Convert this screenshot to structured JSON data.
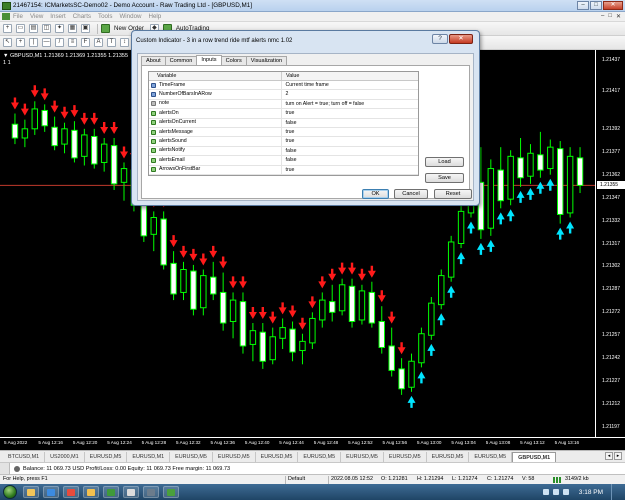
{
  "window": {
    "title": "21467154: ICMarketsSC-Demo02 - Demo Account - Raw Trading Ltd - [GBPUSD,M1]",
    "controls": [
      "–",
      "□",
      "✕"
    ]
  },
  "menu": {
    "items": [
      "File",
      "View",
      "Insert",
      "Charts",
      "Tools",
      "Window",
      "Help"
    ],
    "mdi_controls": [
      "–",
      "□",
      "✕"
    ]
  },
  "toolbar": {
    "new_order": "New Order",
    "autotrading": "AutoTrading"
  },
  "chart": {
    "info_line1": "▼ GBPUSD,M1  1.21369 1.21369 1.21355 1.21355",
    "info_line2": "1   1",
    "current_price": "1.21355",
    "price_ticks": [
      "1.21437",
      "1.21417",
      "1.21392",
      "1.21377",
      "1.21362",
      "1.21347",
      "1.21332",
      "1.21317",
      "1.21302",
      "1.21287",
      "1.21272",
      "1.21257",
      "1.21242",
      "1.21227",
      "1.21212",
      "1.21197"
    ],
    "time_labels": [
      "5 Aug 2022",
      "5 Aug 12:16",
      "5 Aug 12:20",
      "5 Aug 12:24",
      "5 Aug 12:28",
      "5 Aug 12:32",
      "5 Aug 12:36",
      "5 Aug 12:40",
      "5 Aug 12:44",
      "5 Aug 12:48",
      "5 Aug 12:52",
      "5 Aug 12:56",
      "5 Aug 13:00",
      "5 Aug 13:04",
      "5 Aug 13:08",
      "5 Aug 13:12",
      "5 Aug 13:16"
    ],
    "colors": {
      "bull": "#00ff00",
      "bear": "#00ff00",
      "up_arrow": "#00e5ff",
      "down_arrow": "#ff1a1a",
      "price_line": "#c0392b"
    }
  },
  "chart_data": {
    "type": "candlestick",
    "title": "GBPUSD,M1",
    "candles": [
      {
        "o": 1.21395,
        "h": 1.21402,
        "l": 1.21382,
        "c": 1.21386
      },
      {
        "o": 1.21386,
        "h": 1.21398,
        "l": 1.2138,
        "c": 1.21392
      },
      {
        "o": 1.21392,
        "h": 1.2141,
        "l": 1.21388,
        "c": 1.21405
      },
      {
        "o": 1.21404,
        "h": 1.21408,
        "l": 1.2139,
        "c": 1.21394
      },
      {
        "o": 1.21393,
        "h": 1.214,
        "l": 1.21378,
        "c": 1.21381
      },
      {
        "o": 1.21382,
        "h": 1.21396,
        "l": 1.21376,
        "c": 1.21392
      },
      {
        "o": 1.21391,
        "h": 1.21397,
        "l": 1.2137,
        "c": 1.21373
      },
      {
        "o": 1.21374,
        "h": 1.21392,
        "l": 1.21368,
        "c": 1.21388
      },
      {
        "o": 1.21387,
        "h": 1.21392,
        "l": 1.21366,
        "c": 1.21369
      },
      {
        "o": 1.2137,
        "h": 1.21386,
        "l": 1.21364,
        "c": 1.21382
      },
      {
        "o": 1.21381,
        "h": 1.21386,
        "l": 1.21352,
        "c": 1.21356
      },
      {
        "o": 1.21357,
        "h": 1.2137,
        "l": 1.21345,
        "c": 1.21366
      },
      {
        "o": 1.21365,
        "h": 1.21369,
        "l": 1.21338,
        "c": 1.21342
      },
      {
        "o": 1.21343,
        "h": 1.21348,
        "l": 1.21318,
        "c": 1.21322
      },
      {
        "o": 1.21323,
        "h": 1.21338,
        "l": 1.21312,
        "c": 1.21334
      },
      {
        "o": 1.21333,
        "h": 1.21338,
        "l": 1.213,
        "c": 1.21303
      },
      {
        "o": 1.21304,
        "h": 1.21312,
        "l": 1.2128,
        "c": 1.21284
      },
      {
        "o": 1.21285,
        "h": 1.21305,
        "l": 1.2128,
        "c": 1.213
      },
      {
        "o": 1.21299,
        "h": 1.21303,
        "l": 1.2127,
        "c": 1.21274
      },
      {
        "o": 1.21275,
        "h": 1.213,
        "l": 1.2127,
        "c": 1.21296
      },
      {
        "o": 1.21295,
        "h": 1.21305,
        "l": 1.2128,
        "c": 1.21284
      },
      {
        "o": 1.21285,
        "h": 1.21298,
        "l": 1.2126,
        "c": 1.21265
      },
      {
        "o": 1.21266,
        "h": 1.21285,
        "l": 1.21255,
        "c": 1.2128
      },
      {
        "o": 1.21279,
        "h": 1.21285,
        "l": 1.21245,
        "c": 1.2125
      },
      {
        "o": 1.21251,
        "h": 1.21265,
        "l": 1.2124,
        "c": 1.2126
      },
      {
        "o": 1.21259,
        "h": 1.21265,
        "l": 1.21235,
        "c": 1.2124
      },
      {
        "o": 1.21241,
        "h": 1.21262,
        "l": 1.21238,
        "c": 1.21256
      },
      {
        "o": 1.21255,
        "h": 1.21268,
        "l": 1.21248,
        "c": 1.21262
      },
      {
        "o": 1.21261,
        "h": 1.21266,
        "l": 1.2124,
        "c": 1.21246
      },
      {
        "o": 1.21247,
        "h": 1.21258,
        "l": 1.21238,
        "c": 1.21253
      },
      {
        "o": 1.21252,
        "h": 1.21272,
        "l": 1.21248,
        "c": 1.21268
      },
      {
        "o": 1.21267,
        "h": 1.21285,
        "l": 1.21262,
        "c": 1.2128
      },
      {
        "o": 1.21279,
        "h": 1.2129,
        "l": 1.21266,
        "c": 1.21272
      },
      {
        "o": 1.21273,
        "h": 1.21294,
        "l": 1.2127,
        "c": 1.2129
      },
      {
        "o": 1.21289,
        "h": 1.21294,
        "l": 1.21262,
        "c": 1.21266
      },
      {
        "o": 1.21267,
        "h": 1.2129,
        "l": 1.21264,
        "c": 1.21286
      },
      {
        "o": 1.21285,
        "h": 1.21292,
        "l": 1.21262,
        "c": 1.21265
      },
      {
        "o": 1.21266,
        "h": 1.21276,
        "l": 1.21245,
        "c": 1.21249
      },
      {
        "o": 1.2125,
        "h": 1.21262,
        "l": 1.2123,
        "c": 1.21234
      },
      {
        "o": 1.21235,
        "h": 1.21242,
        "l": 1.21218,
        "c": 1.21222
      },
      {
        "o": 1.21223,
        "h": 1.21245,
        "l": 1.2122,
        "c": 1.2124
      },
      {
        "o": 1.21239,
        "h": 1.21262,
        "l": 1.21236,
        "c": 1.21258
      },
      {
        "o": 1.21257,
        "h": 1.21282,
        "l": 1.21254,
        "c": 1.21278
      },
      {
        "o": 1.21277,
        "h": 1.213,
        "l": 1.21274,
        "c": 1.21296
      },
      {
        "o": 1.21295,
        "h": 1.21322,
        "l": 1.21292,
        "c": 1.21318
      },
      {
        "o": 1.21317,
        "h": 1.21342,
        "l": 1.21314,
        "c": 1.21338
      },
      {
        "o": 1.21337,
        "h": 1.21362,
        "l": 1.21334,
        "c": 1.21358
      },
      {
        "o": 1.21357,
        "h": 1.2138,
        "l": 1.2132,
        "c": 1.21326
      },
      {
        "o": 1.21327,
        "h": 1.21372,
        "l": 1.21322,
        "c": 1.21366
      },
      {
        "o": 1.21365,
        "h": 1.2138,
        "l": 1.2134,
        "c": 1.21345
      },
      {
        "o": 1.21346,
        "h": 1.21378,
        "l": 1.21342,
        "c": 1.21374
      },
      {
        "o": 1.21373,
        "h": 1.21386,
        "l": 1.21354,
        "c": 1.2136
      },
      {
        "o": 1.21361,
        "h": 1.21382,
        "l": 1.21356,
        "c": 1.21376
      },
      {
        "o": 1.21375,
        "h": 1.2139,
        "l": 1.2136,
        "c": 1.21365
      },
      {
        "o": 1.21366,
        "h": 1.21385,
        "l": 1.21362,
        "c": 1.2138
      },
      {
        "o": 1.21379,
        "h": 1.21384,
        "l": 1.2133,
        "c": 1.21336
      },
      {
        "o": 1.21337,
        "h": 1.2138,
        "l": 1.21334,
        "c": 1.21374
      },
      {
        "o": 1.21373,
        "h": 1.2138,
        "l": 1.2135,
        "c": 1.21355
      }
    ],
    "up_arrow_indices": [
      40,
      41,
      42,
      43,
      44,
      45,
      46,
      47,
      48,
      49,
      50,
      51,
      52,
      53,
      54,
      55,
      56
    ],
    "down_arrow_indices": [
      0,
      1,
      2,
      3,
      4,
      5,
      6,
      7,
      8,
      9,
      10,
      11,
      12,
      13,
      14,
      15,
      16,
      17,
      18,
      19,
      20,
      21,
      22,
      23,
      24,
      25,
      26,
      27,
      28,
      29,
      30,
      31,
      32,
      33,
      34,
      35,
      36,
      37,
      38,
      39
    ],
    "ylim": [
      1.21197,
      1.21437
    ],
    "current_price": 1.21355
  },
  "dialog": {
    "title": "Custom Indicator - 3 in a row trend ride mtf alerts nmc 1.02",
    "help": "?",
    "close": "✕",
    "tabs": [
      "About",
      "Common",
      "Inputs",
      "Colors",
      "Visualization"
    ],
    "active_tab": "Inputs",
    "table_headers": {
      "variable": "Variable",
      "value": "Value"
    },
    "params": [
      {
        "name": "TimeFrame",
        "value": "Current time frame",
        "icon": "type-blue"
      },
      {
        "name": "NumberOfBarsInARow",
        "value": "2",
        "icon": "type-blue"
      },
      {
        "name": "note",
        "value": "turn on Alert = true; turn off = false",
        "icon": "type-gray"
      },
      {
        "name": "alertsOn",
        "value": "true",
        "icon": "type-green"
      },
      {
        "name": "alertsOnCurrent",
        "value": "false",
        "icon": "type-green"
      },
      {
        "name": "alertsMessage",
        "value": "true",
        "icon": "type-green"
      },
      {
        "name": "alertsSound",
        "value": "true",
        "icon": "type-green"
      },
      {
        "name": "alertsNotify",
        "value": "false",
        "icon": "type-green"
      },
      {
        "name": "alertsEmail",
        "value": "false",
        "icon": "type-green"
      },
      {
        "name": "ArrowsOnFirstBar",
        "value": "true",
        "icon": "type-green"
      }
    ],
    "buttons": {
      "load": "Load",
      "save": "Save",
      "ok": "OK",
      "cancel": "Cancel",
      "reset": "Reset"
    }
  },
  "symbol_tabs": {
    "items": [
      "BTCUSD,M1",
      "US2000,M1",
      "EURUSD,M5",
      "EURUSD,M1",
      "EURUSD,M5",
      "EURUSD,M5",
      "EURUSD,M5",
      "EURUSD,M5",
      "EURUSD,M5",
      "EURUSD,M5",
      "EURUSD,M5",
      "EURUSD,M5",
      "GBPUSD,M1"
    ],
    "active": "GBPUSD,M1"
  },
  "terminal": {
    "balance_text": "Balance: 11 069.73 USD  Profit/Loss: 0.00  Equity: 11 069.73  Free margin: 11 069.73"
  },
  "status": {
    "help": "For Help, press F1",
    "profile": "Default",
    "datetime": "2022.08.05 12:52",
    "open": "O: 1.21281",
    "high": "H: 1.21294",
    "low": "L: 1.21274",
    "close": "C: 1.21274",
    "volume": "V: 58",
    "traffic": "3149/2 kb"
  },
  "taskbar": {
    "clock": "3:18 PM",
    "apps": [
      {
        "name": "explorer",
        "color": "#f1c55a"
      },
      {
        "name": "media-player",
        "color": "#3c8be0"
      },
      {
        "name": "chrome",
        "color": "#e84b3c"
      },
      {
        "name": "folder",
        "color": "#f3c04e"
      },
      {
        "name": "metatrader",
        "color": "#3f9a3a"
      },
      {
        "name": "notepad",
        "color": "#dcdcdc"
      },
      {
        "name": "terminal",
        "color": "#6b7c8c"
      },
      {
        "name": "metatrader-2",
        "color": "#4aa03c"
      }
    ]
  }
}
